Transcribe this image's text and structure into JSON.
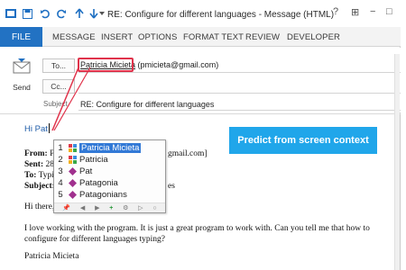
{
  "window": {
    "title": "RE: Configure for different languages - Message (HTML)"
  },
  "window_controls": [
    "?",
    "⊞",
    "−",
    "□"
  ],
  "ribbon": {
    "file_tab": "FILE",
    "tabs": [
      "MESSAGE",
      "INSERT",
      "OPTIONS",
      "FORMAT TEXT",
      "REVIEW",
      "DEVELOPER"
    ]
  },
  "compose": {
    "send_label": "Send",
    "to_button": "To...",
    "cc_button": "Cc...",
    "subject_label": "Subject",
    "to_name": "Patricia Micieta",
    "to_email": "(pmicieta@gmail.com)",
    "subject_value": "RE: Configure for different languages"
  },
  "body": {
    "greeting": "Hi Pat",
    "from_label": "From:",
    "from_value_start": "Pa",
    "from_value_end": "gmail.com]",
    "sent_label": "Sent:",
    "sent_value": "28",
    "to_label": "To:",
    "to_value": "Typi",
    "subject_label": "Subject:",
    "subject_end": "es",
    "hi_there": "Hi there,",
    "para_line1": "I love working with the program.  It is just a great program to work with. Can you tell me that how to",
    "para_line2": "configure for different languages typing?",
    "signature": "Patricia Micieta"
  },
  "predict_button": "Predict from screen context",
  "autocomplete": {
    "items": [
      {
        "num": "1",
        "text": "Patricia Micieta",
        "icon": "grid-icon",
        "selected": true
      },
      {
        "num": "2",
        "text": "Patricia",
        "icon": "grid-icon",
        "selected": false
      },
      {
        "num": "3",
        "text": "Pat",
        "icon": "diamond-icon",
        "selected": false
      },
      {
        "num": "4",
        "text": "Patagonia",
        "icon": "diamond-icon",
        "selected": false
      },
      {
        "num": "5",
        "text": "Patagonians",
        "icon": "diamond-icon",
        "selected": false
      }
    ]
  },
  "colors": {
    "accent": "#2272c3",
    "predict": "#20a6ea",
    "highlight": "#e0334b",
    "selection": "#3279d6"
  }
}
